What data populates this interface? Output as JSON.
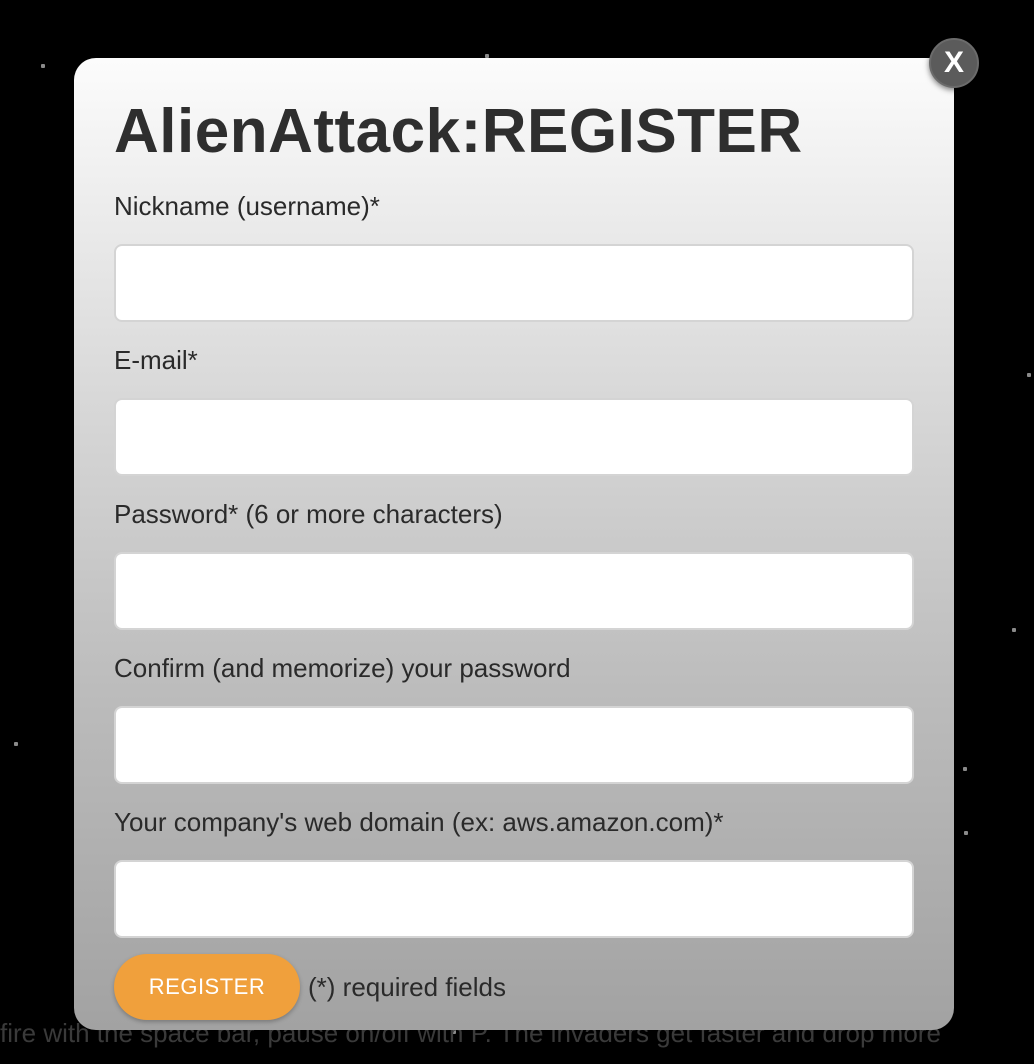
{
  "modal": {
    "title": "AlienAttack:REGISTER",
    "close_label": "X",
    "fields": [
      {
        "label": "Nickname (username)*",
        "value": "",
        "placeholder": ""
      },
      {
        "label": "E-mail*",
        "value": "",
        "placeholder": ""
      },
      {
        "label": "Password* (6 or more characters)",
        "value": "",
        "placeholder": ""
      },
      {
        "label": "Confirm (and memorize) your password",
        "value": "",
        "placeholder": ""
      },
      {
        "label": "Your company's web domain (ex: aws.amazon.com)*",
        "value": "",
        "placeholder": ""
      }
    ],
    "register_label": "REGISTER",
    "required_note": "(*) required fields"
  },
  "background": {
    "instructions": "fire with the space bar, pause on/off with P. The invaders get faster and drop more"
  }
}
